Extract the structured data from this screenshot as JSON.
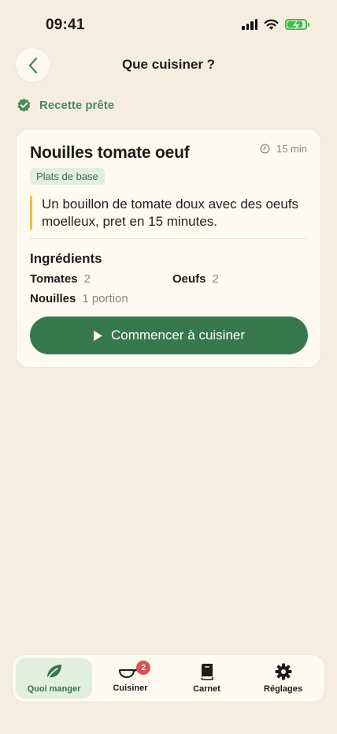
{
  "status_bar": {
    "time": "09:41"
  },
  "header": {
    "title": "Que cuisiner ?"
  },
  "status": {
    "label": "Recette prête"
  },
  "recipe": {
    "title": "Nouilles tomate oeuf",
    "duration": "15 min",
    "category": "Plats de base",
    "description": "Un bouillon de tomate doux avec des oeufs moelleux, pret en 15 minutes.",
    "ingredients_title": "Ingrédients",
    "ingredients": [
      {
        "name": "Tomates",
        "qty": "2"
      },
      {
        "name": "Oeufs",
        "qty": "2"
      },
      {
        "name": "Nouilles",
        "qty": "1 portion"
      }
    ],
    "cta_label": "Commencer à cuisiner"
  },
  "tabs": [
    {
      "label": "Quoi manger",
      "icon": "leaf-icon",
      "active": true
    },
    {
      "label": "Cuisiner",
      "icon": "pan-icon",
      "badge": "2"
    },
    {
      "label": "Carnet",
      "icon": "book-icon"
    },
    {
      "label": "Réglages",
      "icon": "gear-icon"
    }
  ],
  "colors": {
    "background": "#f5eee0",
    "accent": "#37774c",
    "accent_light": "#e3efdd",
    "quote_bar": "#e8c34c",
    "badge": "#d9534f"
  }
}
